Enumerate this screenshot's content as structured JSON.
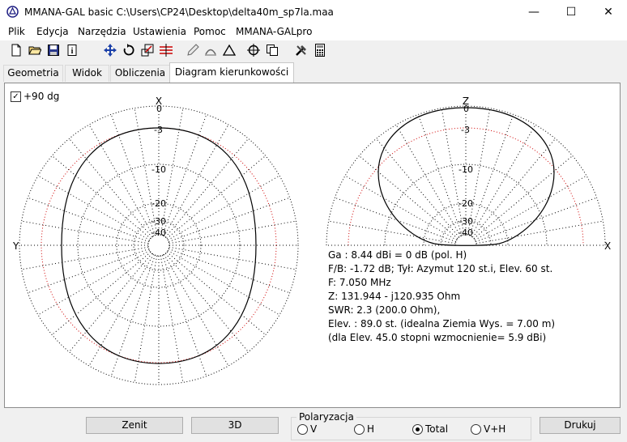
{
  "window": {
    "title": "MMANA-GAL basic  C:\\Users\\CP24\\Desktop\\delta40m_sp7la.maa",
    "minimize": "—",
    "maximize": "☐",
    "close": "✕"
  },
  "menu": [
    "Plik",
    "Edycja",
    "Narzędzia",
    "Ustawienia",
    "Pomoc",
    "MMANA-GALpro"
  ],
  "toolbar_icons": [
    "new-file-icon",
    "open-folder-icon",
    "save-icon",
    "info-icon",
    "move-icon",
    "rotate-icon",
    "scale-icon",
    "segments-icon",
    "pencil-icon",
    "stretch-icon",
    "triangle-icon",
    "crosshair-icon",
    "copy-icon",
    "tools-icon",
    "calculator-icon"
  ],
  "tabs": [
    "Geometria",
    "Widok",
    "Obliczenia",
    "Diagram kierunkowości"
  ],
  "active_tab": 3,
  "checkbox": {
    "label": "+90 dg",
    "checked": true
  },
  "plot_left": {
    "top_label": "X",
    "left_label": "Y",
    "db_labels": [
      "0",
      "-3",
      "-10",
      "-20",
      "-30",
      "-40"
    ]
  },
  "plot_right": {
    "top_label": "Z",
    "right_label": "X",
    "db_labels": [
      "0",
      "-3",
      "-10",
      "-20",
      "-30",
      "-40"
    ]
  },
  "info": [
    "Ga : 8.44 dBi = 0 dB  (pol. H)",
    "F/B: -1.72 dB; Tył: Azymut 120 st.i, Elev. 60 st.",
    "F: 7.050 MHz",
    "Z: 131.944 - j120.935 Ohm",
    "SWR: 2.3 (200.0 Ohm),",
    "Elev. : 89.0 st. (idealna Ziemia Wys. = 7.00 m)",
    "(dla Elev. 45.0 stopni wzmocnienie= 5.9 dBi)"
  ],
  "buttons": {
    "zenit": "Zenit",
    "threed": "3D",
    "print": "Drukuj"
  },
  "polarization": {
    "title": "Polaryzacja",
    "options": [
      "V",
      "H",
      "Total",
      "V+H"
    ],
    "selected": "Total"
  }
}
